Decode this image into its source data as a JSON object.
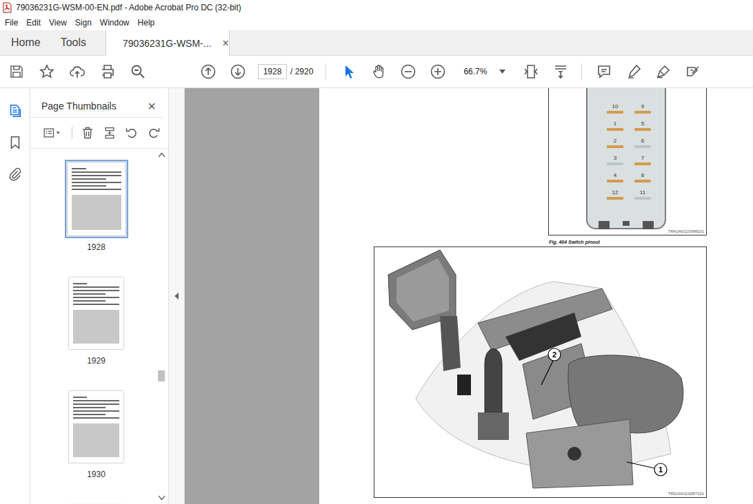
{
  "window": {
    "title": "79036231G-WSM-00-EN.pdf - Adobe Acrobat Pro DC (32-bit)"
  },
  "menu": [
    "File",
    "Edit",
    "View",
    "Sign",
    "Window",
    "Help"
  ],
  "tabs": [
    {
      "label": "Home",
      "selected": false,
      "close": ""
    },
    {
      "label": "Tools",
      "selected": false,
      "close": ""
    },
    {
      "label": "79036231G-WSM-...",
      "selected": true,
      "close": "×"
    }
  ],
  "toolbar": {
    "page_current": "1928",
    "page_total": "/ 2920",
    "zoom": "66.7%"
  },
  "side_panel": {
    "title": "Page Thumbnails",
    "close": "×",
    "thumbnails": [
      {
        "page": "1928",
        "selected": true
      },
      {
        "page": "1929",
        "selected": false
      },
      {
        "page": "1930",
        "selected": false
      },
      {
        "page": "",
        "selected": false
      }
    ]
  },
  "document": {
    "pinout": {
      "code": "TRHJA0110398101",
      "caption": "Fig. 404  Switch pinout",
      "pins": [
        {
          "label": "10",
          "color": "#d39a4c"
        },
        {
          "label": "9",
          "color": "#d39a4c"
        },
        {
          "label": "1",
          "color": "#d39a4c"
        },
        {
          "label": "5",
          "color": "#d39a4c"
        },
        {
          "label": "2",
          "color": "#d39a4c"
        },
        {
          "label": "6",
          "color": "#b9c6cb"
        },
        {
          "label": "3",
          "color": "#b9c6cb"
        },
        {
          "label": "7",
          "color": "#d39a4c"
        },
        {
          "label": "4",
          "color": "#d39a4c"
        },
        {
          "label": "8",
          "color": "#d39a4c"
        },
        {
          "label": "12",
          "color": "#d39a4c"
        },
        {
          "label": "11",
          "color": "#b9c6cb"
        }
      ]
    },
    "illustration": {
      "code": "TRDJA0110287101",
      "callouts": [
        "2",
        "1"
      ]
    }
  }
}
